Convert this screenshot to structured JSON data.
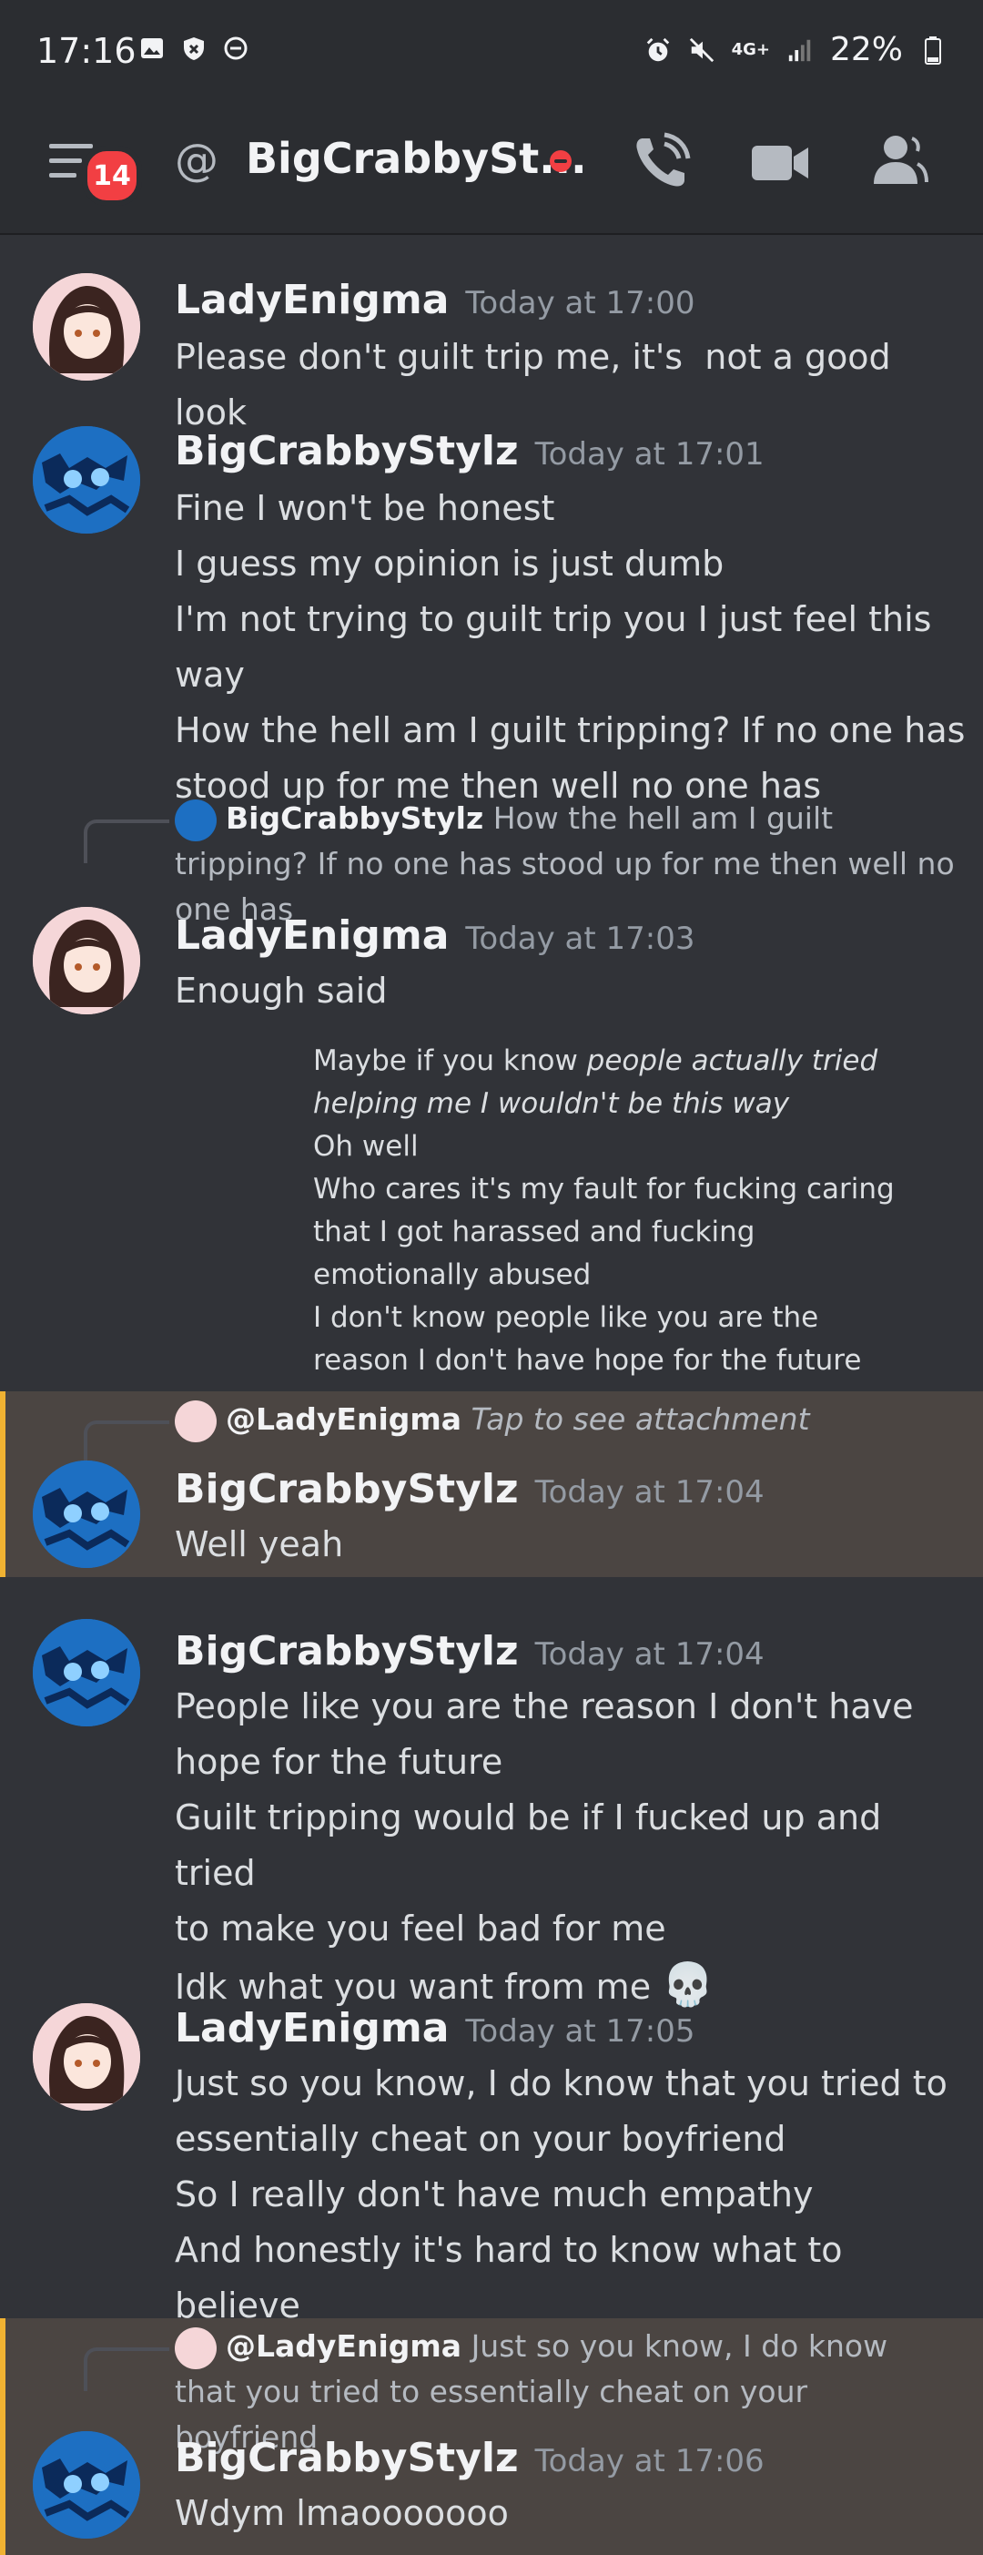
{
  "status": {
    "time": "17:16",
    "network": "4G+",
    "battery": "22%"
  },
  "header": {
    "badge_count": "14",
    "channel_name": "BigCrabbySt..."
  },
  "messages": [
    {
      "author": "LadyEnigma",
      "time": "Today at 17:00",
      "lines": "Please don't guilt trip me, it's  not a good look"
    },
    {
      "author": "BigCrabbyStylz",
      "time": "Today at 17:01",
      "lines": "Fine I won't be honest\nI guess my opinion is just dumb\nI'm not trying to guilt trip you I just feel this way\nHow the hell am I guilt tripping? If no one has\nstood up for me then well no one has"
    },
    {
      "author": "LadyEnigma",
      "time": "Today at 17:03",
      "lines": "Enough said",
      "reply_to": "BigCrabbyStylz",
      "reply_text": "How the hell am I guilt tripping? If no one has stood up for me then well no one has"
    },
    {
      "author": "BigCrabbyStylz",
      "time": "Today at 17:04",
      "lines": "Well yeah",
      "reply_to": "@LadyEnigma",
      "reply_text": "Tap to see attachment"
    },
    {
      "author": "BigCrabbyStylz",
      "time": "Today at 17:04",
      "lines": "People like you are the reason I don't have\nhope for the future\nGuilt tripping would be if I fucked up and tried\nto make you feel bad for me\nIdk what you want from me"
    },
    {
      "author": "LadyEnigma",
      "time": "Today at 17:05",
      "lines": "Just so you know, I do know that you tried to\nessentially cheat on your boyfriend\nSo I really don't have much empathy\nAnd honestly it's hard to know what to believe"
    },
    {
      "author": "BigCrabbyStylz",
      "time": "Today at 17:06",
      "lines": "Wdym lmaooooooo",
      "reply_to": "@LadyEnigma",
      "reply_text": "Just so you know, I do know that you tried to essentially cheat on your boyfriend"
    }
  ],
  "attachment": {
    "line1_plain": "Maybe if you know ",
    "line1_italic": "people actually tried helping me I wouldn't be this way",
    "rest": "Oh well\nWho cares it's my fault for fucking caring that I got harassed and fucking emotionally abused\nI don't know people like you are the reason I don't have hope for the future"
  },
  "skull_emoji": "💀"
}
